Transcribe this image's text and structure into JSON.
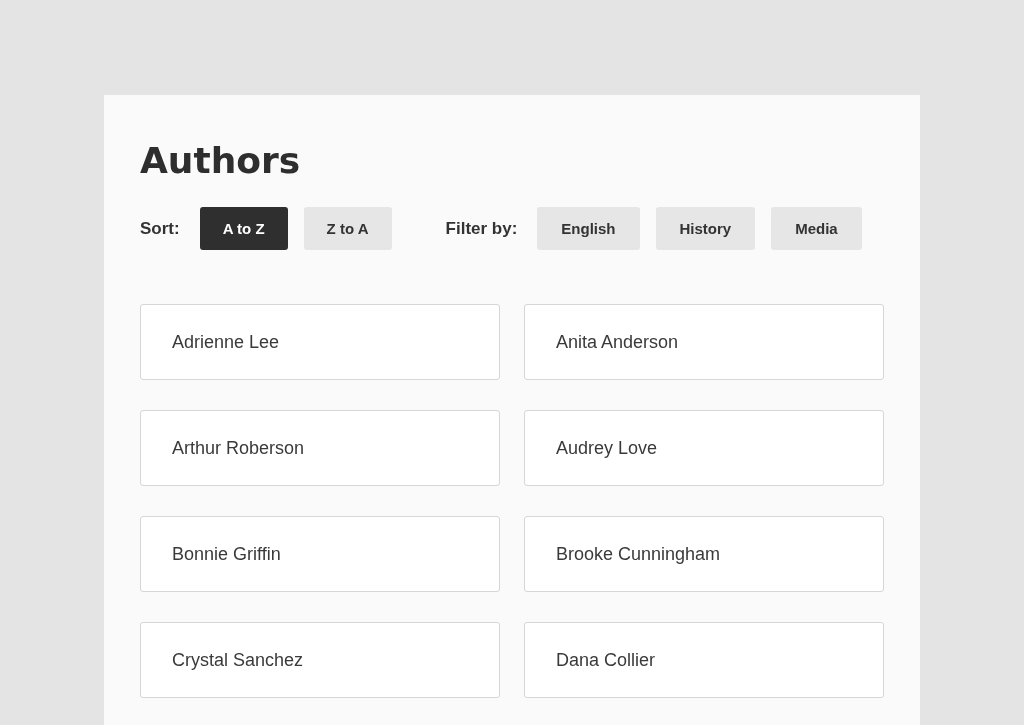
{
  "title": "Authors",
  "sort": {
    "label": "Sort:",
    "options": [
      {
        "label": "A to Z",
        "selected": true
      },
      {
        "label": "Z to A",
        "selected": false
      }
    ]
  },
  "filter": {
    "label": "Filter by:",
    "options": [
      {
        "label": "English",
        "selected": false
      },
      {
        "label": "History",
        "selected": false
      },
      {
        "label": "Media",
        "selected": false
      }
    ]
  },
  "authors": [
    "Adrienne Lee",
    "Anita Anderson",
    "Arthur Roberson",
    "Audrey Love",
    "Bonnie Griffin",
    "Brooke Cunningham",
    "Crystal Sanchez",
    "Dana Collier"
  ]
}
